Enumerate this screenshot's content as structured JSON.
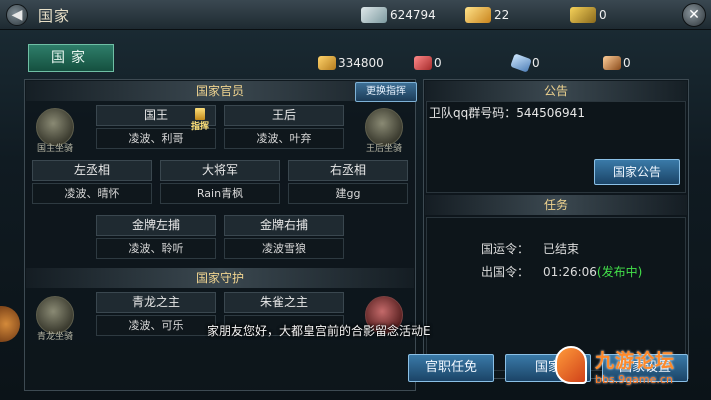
{
  "header": {
    "title": "国家",
    "back_icon": "back-arrow-icon",
    "close_icon": "close-icon",
    "resources": [
      {
        "icon": "silver-ingot-icon",
        "value": "624794"
      },
      {
        "icon": "gold-ingot-icon",
        "value": "22"
      },
      {
        "icon": "treasure-chest-icon",
        "value": "0"
      }
    ]
  },
  "tab": {
    "label": "国家"
  },
  "subresources": [
    {
      "icon": "ticket-icon",
      "value": "334800"
    },
    {
      "icon": "meat-icon",
      "value": "0"
    },
    {
      "icon": "gem-icon",
      "value": "0"
    },
    {
      "icon": "hammer-icon",
      "value": "0"
    }
  ],
  "officials": {
    "heading": "国家官员",
    "swap_button": "更换指挥",
    "command_tag": "指挥",
    "king_mount": "国主坐骑",
    "queen_mount": "王后坐骑",
    "posts": [
      {
        "title": "国王",
        "holder": "凌波、利哥"
      },
      {
        "title": "王后",
        "holder": "凌波、叶弃"
      },
      {
        "title": "左丞相",
        "holder": "凌波、晴怀"
      },
      {
        "title": "大将军",
        "holder": "Rain青枫"
      },
      {
        "title": "右丞相",
        "holder": "建gg"
      },
      {
        "title": "金牌左捕",
        "holder": "凌波、聆听"
      },
      {
        "title": "金牌右捕",
        "holder": "凌波雪狼"
      }
    ]
  },
  "guardians": {
    "heading": "国家守护",
    "left_mount": "青龙坐骑",
    "posts": [
      {
        "title": "青龙之主",
        "holder": "凌波、可乐"
      },
      {
        "title": "朱雀之主",
        "holder": ""
      }
    ]
  },
  "notice": {
    "heading": "公告",
    "text": "卫队qq群号码：544506941",
    "button": "国家公告"
  },
  "tasks": {
    "heading": "任务",
    "rows": [
      {
        "label": "国运令：",
        "value": "已结束",
        "extra": ""
      },
      {
        "label": "出国令：",
        "value": "01:26:06",
        "extra": "(发布中)"
      }
    ]
  },
  "subtitle": "家朋友您好，大都皇宫前的合影留念活动E",
  "bottom_buttons": [
    "官职任免",
    "国家",
    "国家设置"
  ],
  "watermark": {
    "title": "九游论坛",
    "url": "bbs.9game.cn"
  },
  "colors": {
    "green": "#43e04a",
    "gold": "#f0d490",
    "accent_blue": "#3a7aa8"
  }
}
